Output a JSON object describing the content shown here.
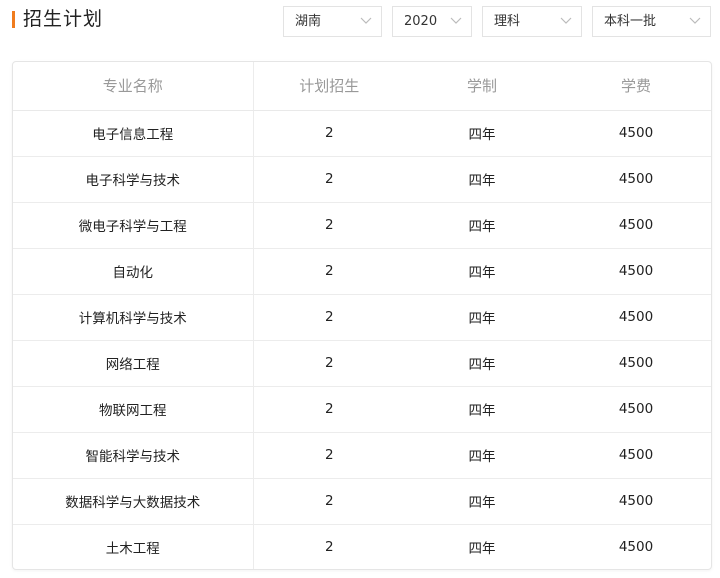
{
  "page": {
    "title": "招生计划",
    "accent_color": "#f07c1e"
  },
  "filters": {
    "province": "湖南",
    "year": "2020",
    "category": "理科",
    "batch": "本科一批"
  },
  "table": {
    "headers": [
      "专业名称",
      "计划招生",
      "学制",
      "学费"
    ],
    "rows": [
      [
        "电子信息工程",
        "2",
        "四年",
        "4500"
      ],
      [
        "电子科学与技术",
        "2",
        "四年",
        "4500"
      ],
      [
        "微电子科学与工程",
        "2",
        "四年",
        "4500"
      ],
      [
        "自动化",
        "2",
        "四年",
        "4500"
      ],
      [
        "计算机科学与技术",
        "2",
        "四年",
        "4500"
      ],
      [
        "网络工程",
        "2",
        "四年",
        "4500"
      ],
      [
        "物联网工程",
        "2",
        "四年",
        "4500"
      ],
      [
        "智能科学与技术",
        "2",
        "四年",
        "4500"
      ],
      [
        "数据科学与大数据技术",
        "2",
        "四年",
        "4500"
      ],
      [
        "土木工程",
        "2",
        "四年",
        "4500"
      ]
    ]
  }
}
